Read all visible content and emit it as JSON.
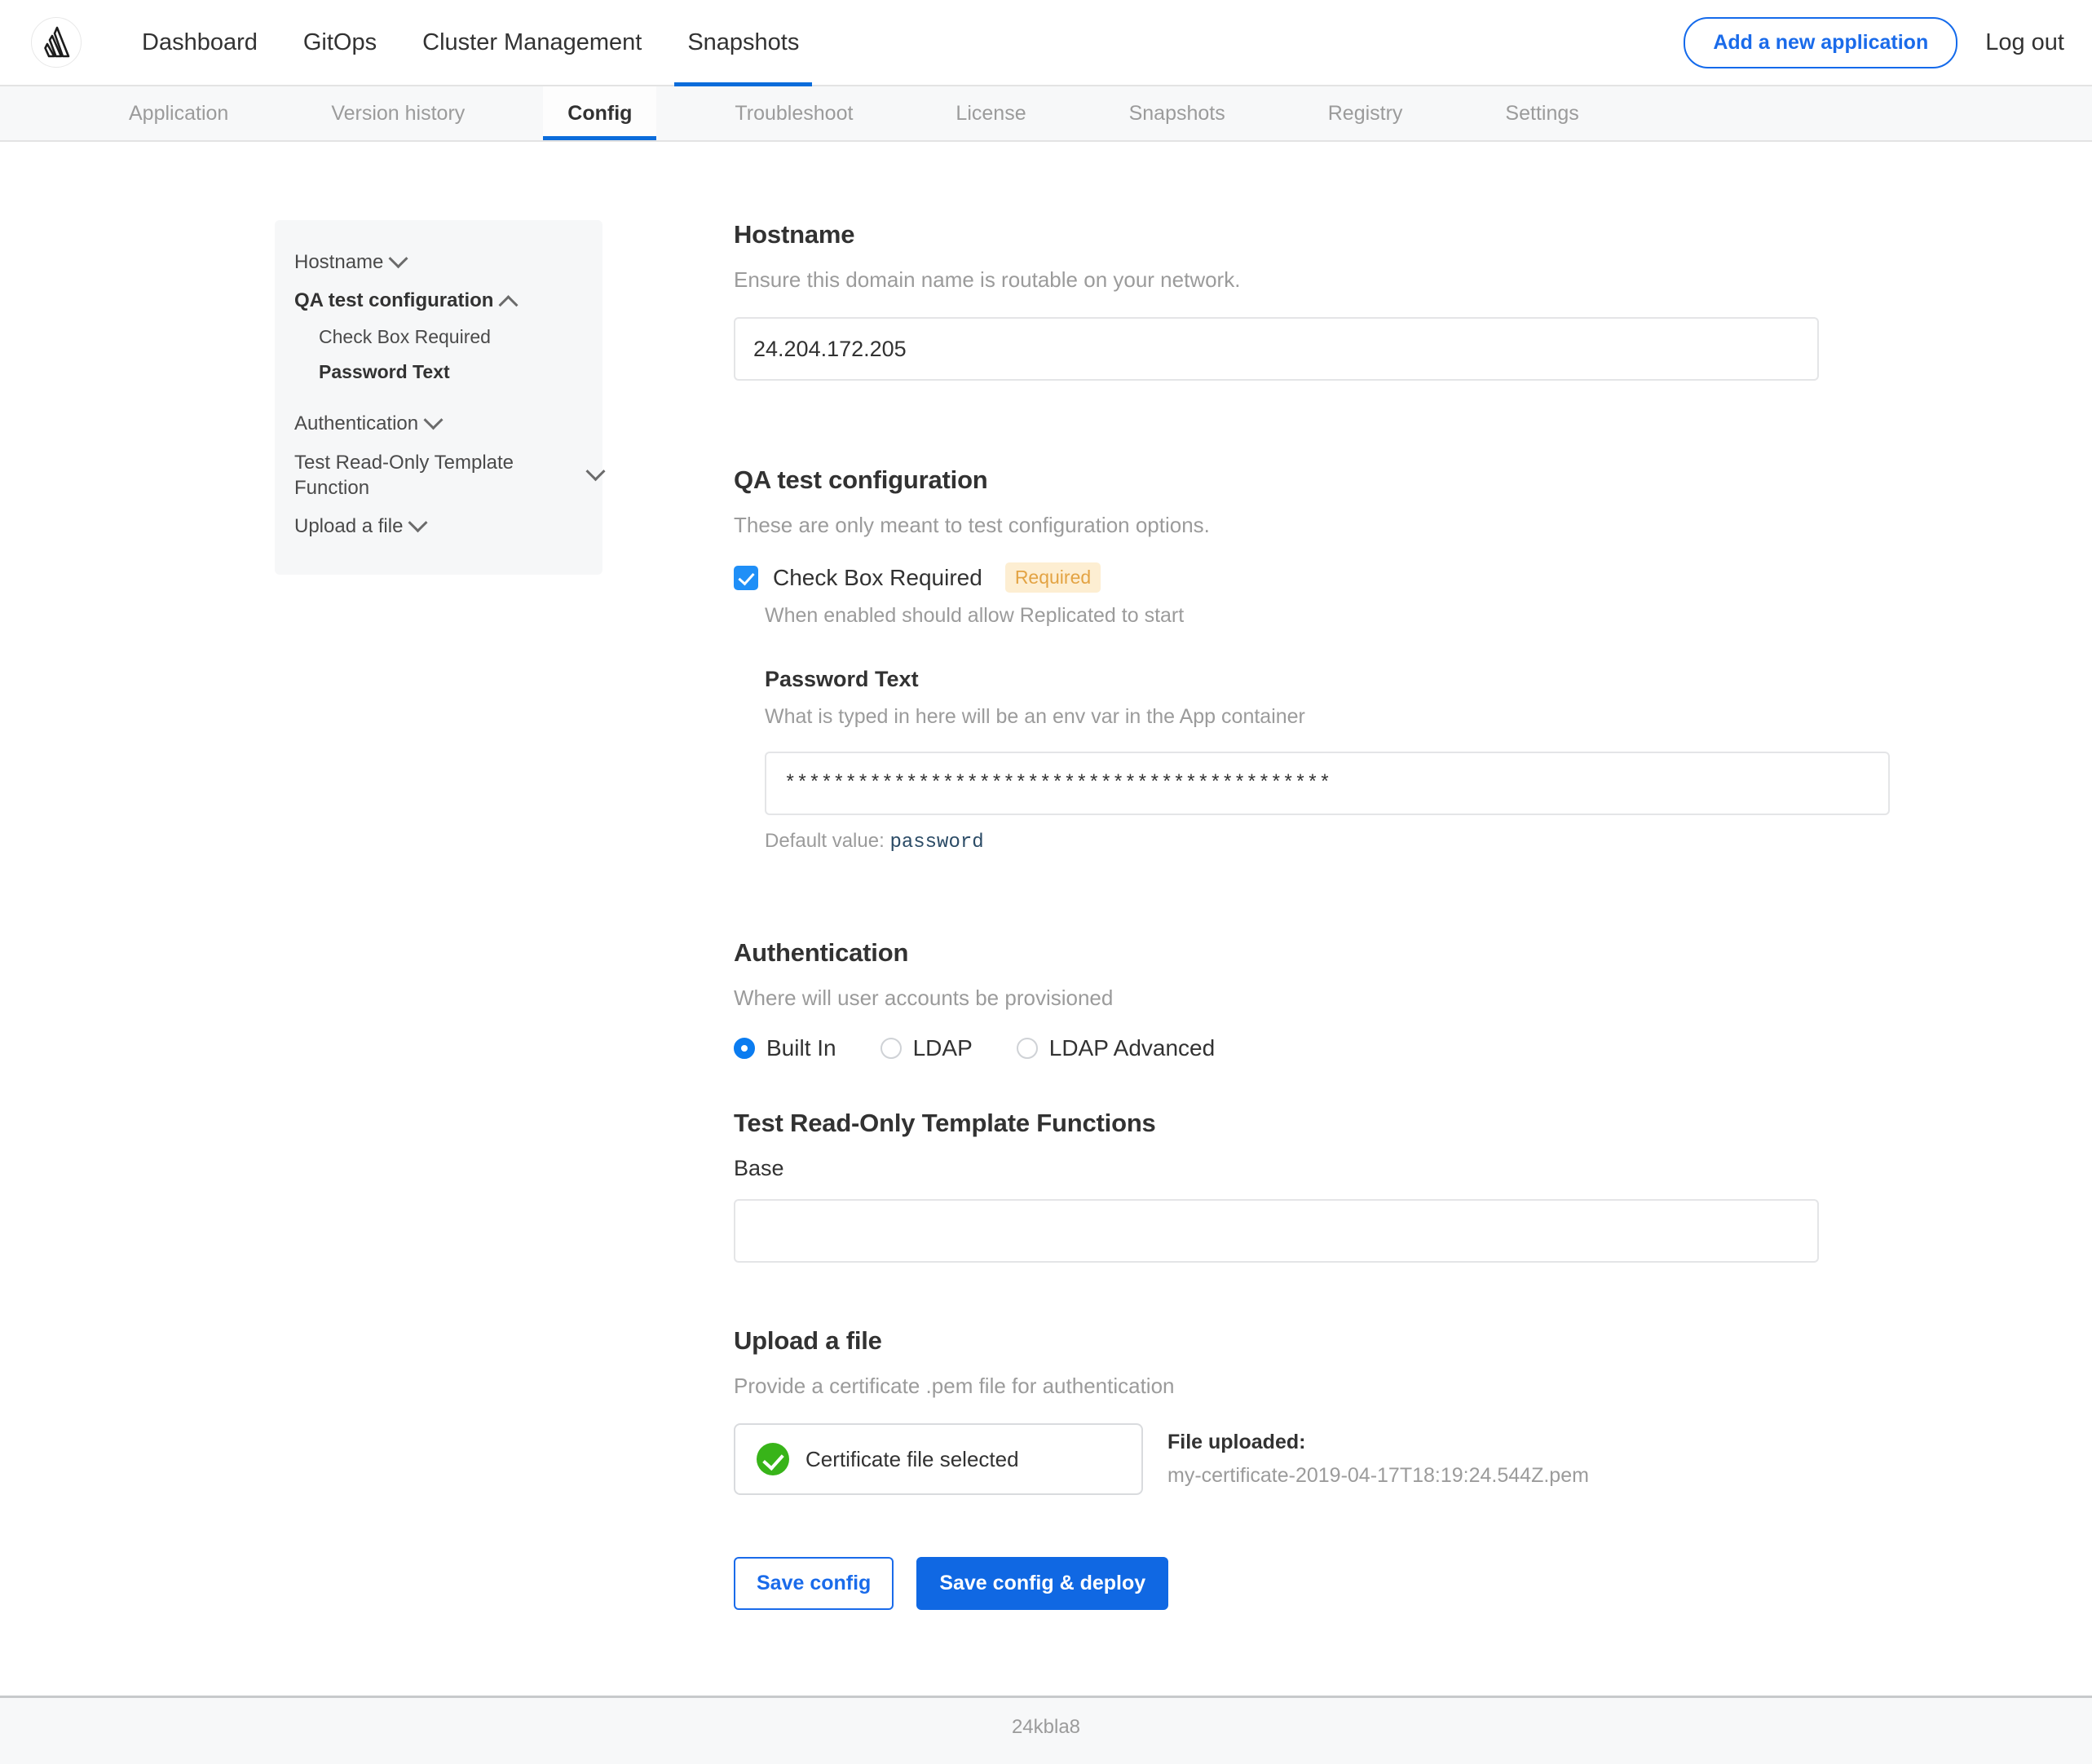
{
  "header": {
    "logo_icon": "replicated-logo-icon",
    "nav": [
      {
        "label": "Dashboard",
        "active": false
      },
      {
        "label": "GitOps",
        "active": false
      },
      {
        "label": "Cluster Management",
        "active": false
      },
      {
        "label": "Snapshots",
        "active": true
      }
    ],
    "add_application_label": "Add a new application",
    "logout_label": "Log out"
  },
  "subnav": [
    {
      "label": "Application",
      "active": false
    },
    {
      "label": "Version history",
      "active": false
    },
    {
      "label": "Config",
      "active": true
    },
    {
      "label": "Troubleshoot",
      "active": false
    },
    {
      "label": "License",
      "active": false
    },
    {
      "label": "Snapshots",
      "active": false
    },
    {
      "label": "Registry",
      "active": false
    },
    {
      "label": "Settings",
      "active": false
    }
  ],
  "sidebar": {
    "items": [
      {
        "label": "Hostname",
        "chevron": "chevron-down-icon",
        "bold": false
      },
      {
        "label": "QA test configuration",
        "chevron": "chevron-up-icon",
        "bold": true
      },
      {
        "label": "Check Box Required",
        "sub": true,
        "bold": false
      },
      {
        "label": "Password Text",
        "sub": true,
        "bold": true
      },
      {
        "label": "Authentication",
        "chevron": "chevron-down-icon",
        "bold": false
      },
      {
        "label": "Test Read-Only Template Function",
        "chevron": "chevron-down-icon",
        "bold": false
      },
      {
        "label": "Upload a file",
        "chevron": "chevron-down-icon",
        "bold": false
      }
    ]
  },
  "hostname": {
    "title": "Hostname",
    "description": "Ensure this domain name is routable on your network.",
    "value": "24.204.172.205",
    "placeholder": ""
  },
  "qa": {
    "title": "QA test configuration",
    "description": "These are only meant to test configuration options.",
    "checkbox": {
      "label": "Check Box Required",
      "badge": "Required",
      "checked": true,
      "help": "When enabled should allow Replicated to start"
    },
    "password": {
      "title": "Password Text",
      "description": "What is typed in here will be an env var in the App container",
      "value": "*********************************************",
      "placeholder": "",
      "default_label": "Default value:",
      "default_value": "password"
    }
  },
  "authentication": {
    "title": "Authentication",
    "description": "Where will user accounts be provisioned",
    "options": [
      {
        "label": "Built In",
        "selected": true
      },
      {
        "label": "LDAP",
        "selected": false
      },
      {
        "label": "LDAP Advanced",
        "selected": false
      }
    ]
  },
  "template_functions": {
    "title": "Test Read-Only Template Functions",
    "field_label": "Base",
    "value": "",
    "placeholder": ""
  },
  "upload": {
    "title": "Upload a file",
    "description": "Provide a certificate .pem file for authentication",
    "status_icon": "check-circle-icon",
    "status_label": "Certificate file selected",
    "uploaded_label": "File uploaded:",
    "uploaded_filename": "my-certificate-2019-04-17T18:19:24.544Z.pem"
  },
  "actions": {
    "save_label": "Save config",
    "save_deploy_label": "Save config & deploy"
  },
  "footer": {
    "text": "24kbla8"
  },
  "colors": {
    "accent_blue": "#1068e3",
    "link_blue": "#1a6bea",
    "checkbox_blue": "#1f8ff7",
    "badge_bg": "#fdeed2",
    "badge_text": "#e3a343",
    "success_green": "#38b419",
    "muted_text": "#9b9b9b",
    "sidebar_bg": "#f6f7f8"
  }
}
